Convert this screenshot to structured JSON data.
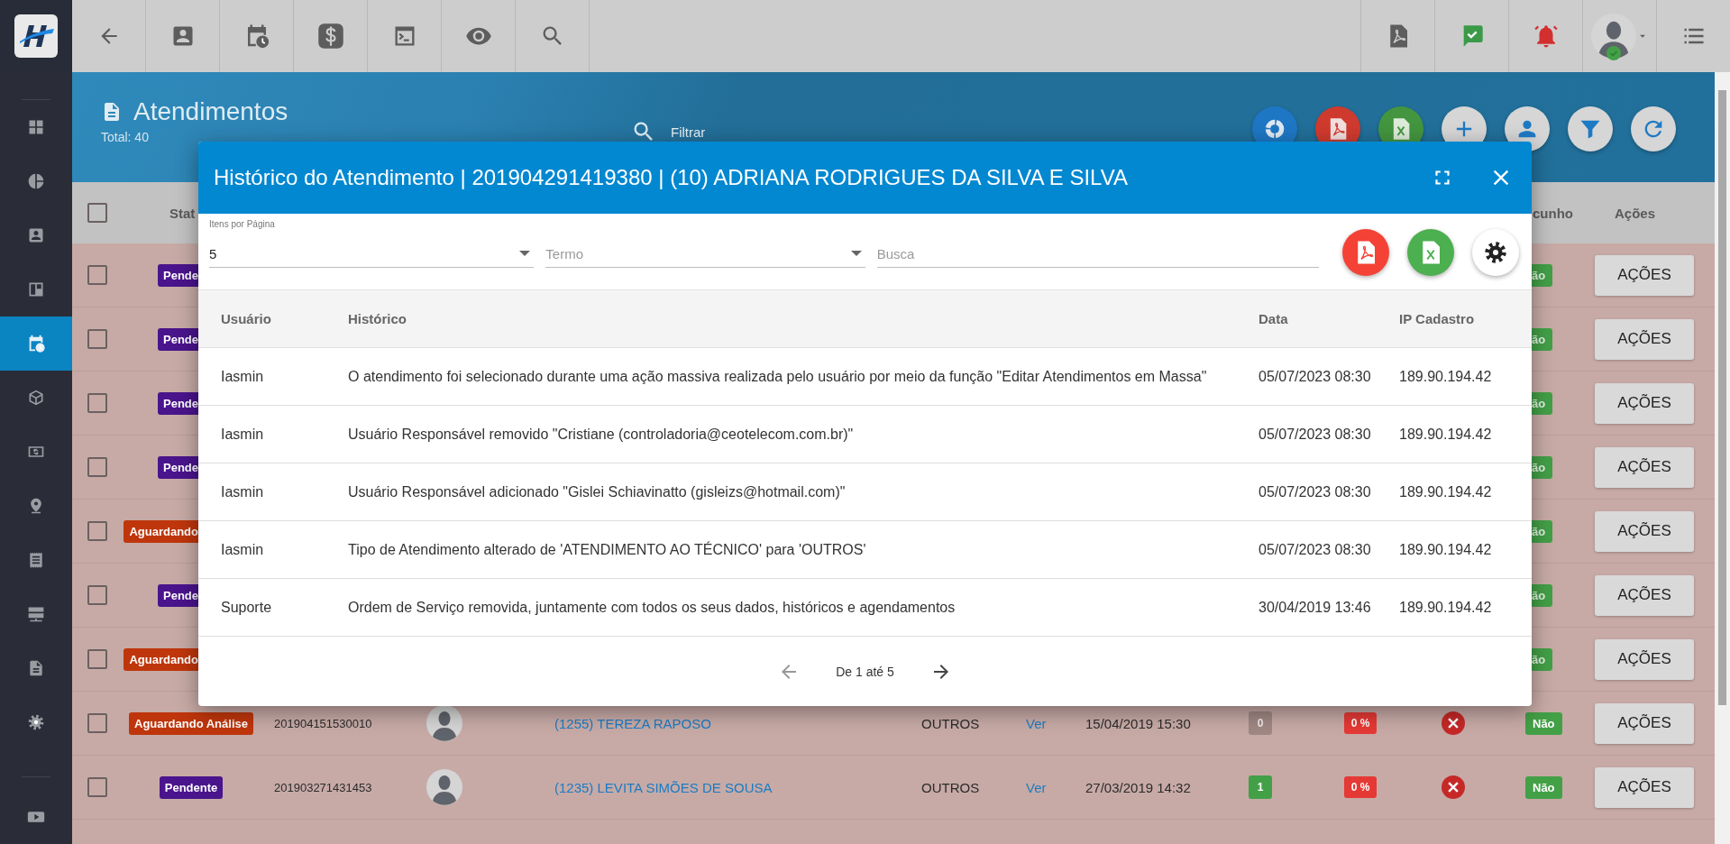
{
  "sidebar": {
    "items": [
      {
        "selected": false
      },
      {
        "selected": false
      },
      {
        "selected": false
      },
      {
        "selected": false
      },
      {
        "selected": true
      },
      {
        "selected": false
      },
      {
        "selected": false
      },
      {
        "selected": false
      },
      {
        "selected": false
      },
      {
        "selected": false
      },
      {
        "selected": false
      },
      {
        "selected": false
      }
    ]
  },
  "page": {
    "title": "Atendimentos",
    "total": "Total: 40",
    "filter_placeholder": "Filtrar"
  },
  "table": {
    "select_all_checked": false,
    "columns": [
      "Stat",
      "cunho",
      "Ações"
    ],
    "rows": [
      {
        "kind": "covered",
        "checked": false,
        "status": "Pende",
        "color": "#4a148c",
        "draft": "ão",
        "action": "AÇÕES"
      },
      {
        "kind": "covered",
        "checked": false,
        "status": "Pende",
        "color": "#4a148c",
        "draft": "ão",
        "action": "AÇÕES"
      },
      {
        "kind": "covered",
        "checked": false,
        "status": "Pende",
        "color": "#4a148c",
        "draft": "ão",
        "action": "AÇÕES"
      },
      {
        "kind": "covered",
        "checked": false,
        "status": "Pende",
        "color": "#4a148c",
        "draft": "ão",
        "action": "AÇÕES"
      },
      {
        "kind": "covered",
        "checked": false,
        "status": "Aguardando",
        "color": "#bf360c",
        "draft": "ão",
        "action": "AÇÕES"
      },
      {
        "kind": "covered",
        "checked": false,
        "status": "Pende",
        "color": "#4a148c",
        "draft": "ão",
        "action": "AÇÕES"
      },
      {
        "kind": "covered",
        "checked": false,
        "status": "Aguardando",
        "color": "#bf360c",
        "draft": "ão",
        "action": "AÇÕES"
      },
      {
        "kind": "full",
        "checked": false,
        "status": "Aguardando Análise",
        "color": "#bf360c",
        "protocol": "201904151530010",
        "client": "(1255) TEREZA RAPOSO",
        "type": "OUTROS",
        "link": "Ver",
        "date": "15/04/2019 15:30",
        "count": "0",
        "count_active": false,
        "percent": "0 %",
        "draft": "Não",
        "action": "AÇÕES"
      },
      {
        "kind": "full",
        "checked": false,
        "status": "Pendente",
        "color": "#4a148c",
        "protocol": "201903271431453",
        "client": "(1235) LEVITA SIMÕES DE SOUSA",
        "type": "OUTROS",
        "link": "Ver",
        "date": "27/03/2019 14:32",
        "count": "1",
        "count_active": true,
        "percent": "0 %",
        "draft": "Não",
        "action": "AÇÕES"
      }
    ]
  },
  "modal": {
    "title": "Histórico do Atendimento | 201904291419380 | (10) ADRIANA RODRIGUES DA SILVA E SILVA",
    "per_page_label": "Itens por Página",
    "per_page": "5",
    "term_placeholder": "Termo",
    "search_placeholder": "Busca",
    "columns": [
      "Usuário",
      "Histórico",
      "Data",
      "IP Cadastro"
    ],
    "rows": [
      {
        "user": "Iasmin",
        "history": "O atendimento foi selecionado durante uma ação massiva realizada pelo usuário por meio da função \"Editar Atendimentos em Massa\"",
        "date": "05/07/2023 08:30",
        "ip": "189.90.194.42"
      },
      {
        "user": "Iasmin",
        "history": "Usuário Responsável removido \"Cristiane (controladoria@ceotelecom.com.br)\"",
        "date": "05/07/2023 08:30",
        "ip": "189.90.194.42"
      },
      {
        "user": "Iasmin",
        "history": "Usuário Responsável adicionado \"Gislei Schiavinatto (gisleizs@hotmail.com)\"",
        "date": "05/07/2023 08:30",
        "ip": "189.90.194.42"
      },
      {
        "user": "Iasmin",
        "history": "Tipo de Atendimento alterado de 'ATENDIMENTO AO TÉCNICO' para 'OUTROS'",
        "date": "05/07/2023 08:30",
        "ip": "189.90.194.42"
      },
      {
        "user": "Suporte",
        "history": "Ordem de Serviço removida, juntamente com todos os seus dados, históricos e agendamentos",
        "date": "30/04/2019 13:46",
        "ip": "189.90.194.42"
      }
    ],
    "pagination": "De 1 até 5"
  }
}
